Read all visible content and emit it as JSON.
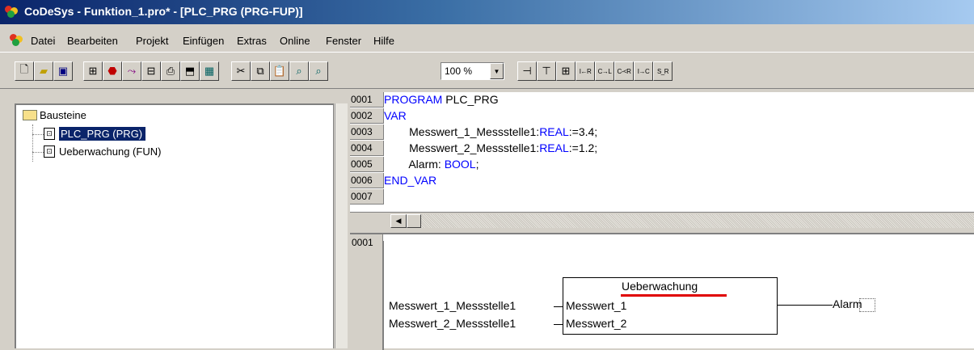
{
  "window": {
    "title": "CoDeSys - Funktion_1.pro* - [PLC_PRG (PRG-FUP)]"
  },
  "menu": [
    "Datei",
    "Bearbeiten",
    "Projekt",
    "Einfügen",
    "Extras",
    "Online",
    "Fenster",
    "Hilfe"
  ],
  "toolbar": {
    "zoom_value": "100 %"
  },
  "object_tree": {
    "root": "Bausteine",
    "items": [
      {
        "label": "PLC_PRG (PRG)",
        "selected": true
      },
      {
        "label": "Ueberwachung (FUN)",
        "selected": false
      }
    ]
  },
  "declaration": {
    "lines": [
      {
        "num": "0001",
        "parts": [
          [
            "kw",
            "PROGRAM"
          ],
          [
            "t",
            " PLC_PRG"
          ]
        ]
      },
      {
        "num": "0002",
        "parts": [
          [
            "kw",
            "VAR"
          ]
        ]
      },
      {
        "num": "0003",
        "parts": [
          [
            "t",
            "        Messwert_1_Messstelle1:"
          ],
          [
            "kw",
            "REAL"
          ],
          [
            "t",
            ":=3.4;"
          ]
        ]
      },
      {
        "num": "0004",
        "parts": [
          [
            "t",
            "        Messwert_2_Messstelle1:"
          ],
          [
            "kw",
            "REAL"
          ],
          [
            "t",
            ":=1.2;"
          ]
        ]
      },
      {
        "num": "0005",
        "parts": [
          [
            "t",
            "        Alarm: "
          ],
          [
            "kw",
            "BOOL"
          ],
          [
            "t",
            ";"
          ]
        ]
      },
      {
        "num": "0006",
        "parts": [
          [
            "kw",
            "END_VAR"
          ]
        ]
      },
      {
        "num": "0007",
        "parts": []
      }
    ]
  },
  "network": {
    "number": "0001",
    "input_1": "Messwert_1_Messstelle1",
    "input_2": "Messwert_2_Messstelle1",
    "block_name": "Ueberwachung",
    "block_in_1": "Messwert_1",
    "block_in_2": "Messwert_2",
    "output": "Alarm"
  },
  "colors": {
    "keyword": "#0000ff",
    "title_gradient_start": "#0a246a",
    "selection": "#0a246a",
    "highlight_underline": "#e00000"
  }
}
